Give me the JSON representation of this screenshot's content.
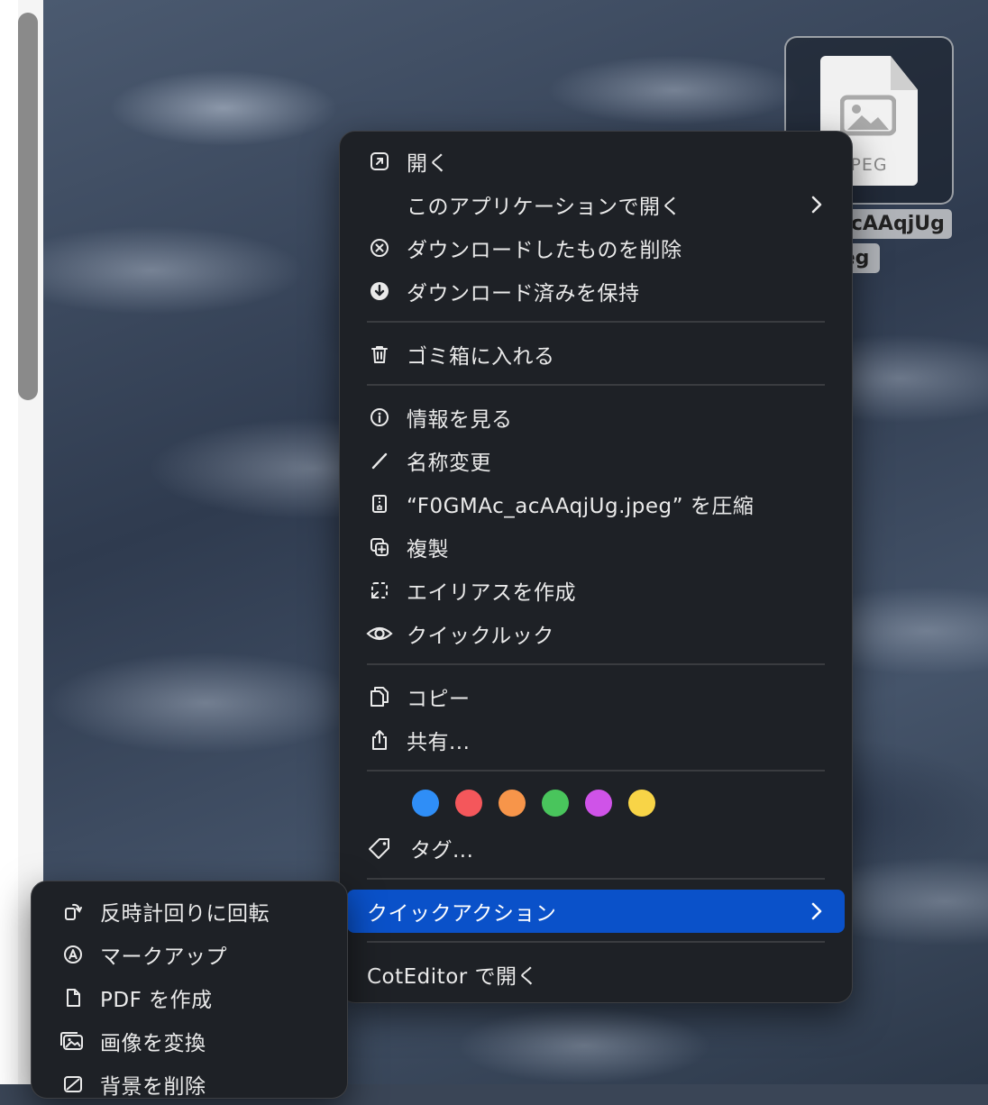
{
  "file": {
    "ext_label": "PEG",
    "name_line1": "_acAAqjUg",
    "name_line2": "peg"
  },
  "menu": {
    "open": "開く",
    "open_with": "このアプリケーションで開く",
    "delete_download": "ダウンロードしたものを削除",
    "keep_download": "ダウンロード済みを保持",
    "move_to_trash": "ゴミ箱に入れる",
    "get_info": "情報を見る",
    "rename": "名称変更",
    "compress": "“F0GMAc_acAAqjUg.jpeg” を圧縮",
    "duplicate": "複製",
    "make_alias": "エイリアスを作成",
    "quick_look": "クイックルック",
    "copy": "コピー",
    "share": "共有...",
    "tags": "タグ...",
    "quick_actions": "クイックアクション",
    "open_in_coteditor": "CotEditor で開く"
  },
  "tag_colors": [
    "#2f8ef7",
    "#f4575b",
    "#f7954a",
    "#49c55c",
    "#cf53e8",
    "#f8d447"
  ],
  "submenu": {
    "rotate_left": "反時計回りに回転",
    "markup": "マークアップ",
    "create_pdf": "PDF を作成",
    "convert_image": "画像を変換",
    "remove_background": "背景を削除"
  },
  "colors": {
    "menu_bg": "#1e2126",
    "highlight": "#0a51c9"
  }
}
